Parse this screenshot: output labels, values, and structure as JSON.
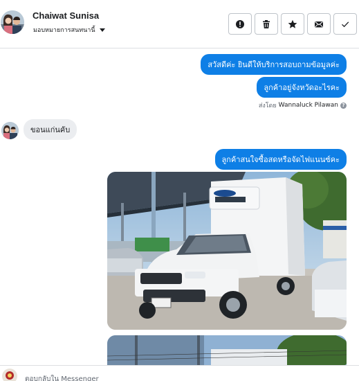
{
  "header": {
    "contact_name": "Chaiwat Sunisa",
    "assign_label": "มอบหมายการสนทนานี้",
    "actions": [
      {
        "name": "report",
        "icon": "exclamation-circle-icon"
      },
      {
        "name": "delete",
        "icon": "trash-icon"
      },
      {
        "name": "star",
        "icon": "star-icon"
      },
      {
        "name": "mark-unread",
        "icon": "envelope-icon"
      },
      {
        "name": "mark-done",
        "icon": "checkmark-icon"
      }
    ]
  },
  "messages": {
    "out_1": "สวัสดีค่ะ  ยินดีให้บริการสอบถามข้อมูลค่ะ",
    "out_2": "ลูกค้าอยู่จังหวัดอะไรคะ",
    "sent_by_prefix": "ส่งโดย",
    "sent_by_name": "Wannaluck Pilawan",
    "in_1": "ขอนแก่นคับ",
    "out_3": "ลูกค้าสนใจซื้อสดหรือจัดไฟแนนซ์คะ"
  },
  "footer": {
    "reply_in": "ตอบกลับใน Messenger"
  },
  "colors": {
    "accent": "#0e7fe6",
    "incoming_bg": "#ebedf0"
  }
}
